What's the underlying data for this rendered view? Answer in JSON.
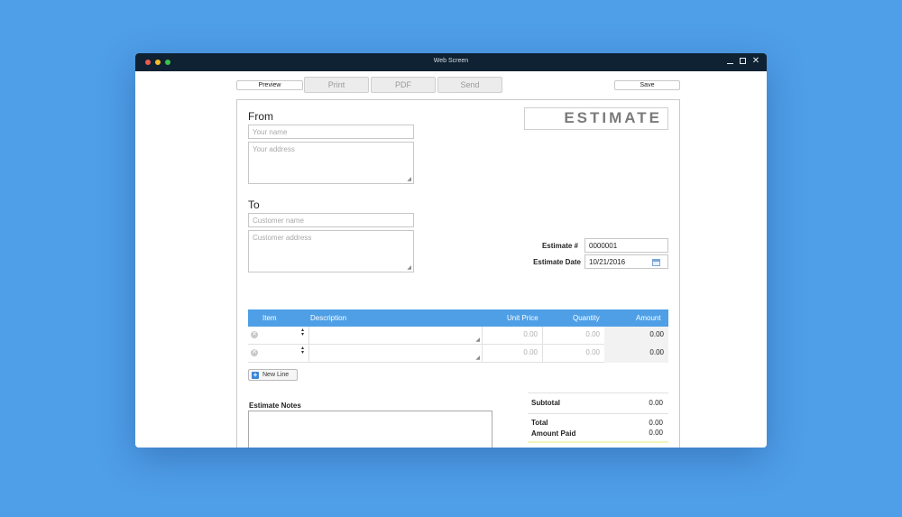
{
  "window": {
    "title": "Web Screen"
  },
  "toolbar": {
    "preview": "Preview",
    "print": "Print",
    "pdf": "PDF",
    "send": "Send",
    "save": "Save"
  },
  "doc_title": "ESTIMATE",
  "from": {
    "label": "From",
    "name_placeholder": "Your name",
    "address_placeholder": "Your address"
  },
  "to": {
    "label": "To",
    "name_placeholder": "Customer name",
    "address_placeholder": "Customer address"
  },
  "meta": {
    "number_label": "Estimate #",
    "number_value": "0000001",
    "date_label": "Estimate Date",
    "date_value": "10/21/2016"
  },
  "table": {
    "headers": {
      "item": "Item",
      "description": "Description",
      "unit_price": "Unit Price",
      "quantity": "Quantity",
      "amount": "Amount"
    },
    "rows": [
      {
        "unit_price": "0.00",
        "quantity": "0.00",
        "amount": "0.00"
      },
      {
        "unit_price": "0.00",
        "quantity": "0.00",
        "amount": "0.00"
      }
    ]
  },
  "new_line": "New Line",
  "notes_label": "Estimate Notes",
  "totals": {
    "subtotal_label": "Subtotal",
    "subtotal_value": "0.00",
    "total_label": "Total",
    "total_value": "0.00",
    "paid_label": "Amount Paid",
    "paid_value": "0.00"
  },
  "colors": {
    "background": "#4f9ee8",
    "header": "#4f9fe6",
    "titlebar": "#0f2233"
  }
}
